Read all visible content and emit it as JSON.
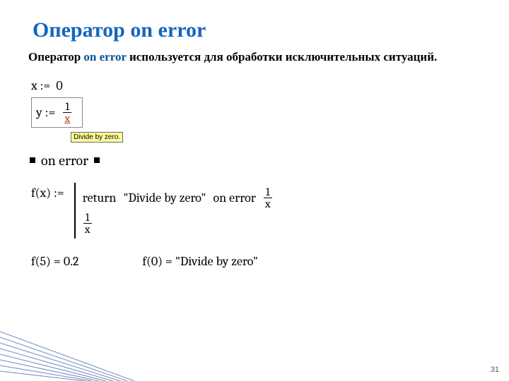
{
  "title": {
    "ru": "Оператор ",
    "kw": "on error"
  },
  "intro": {
    "pre": "Оператор ",
    "op": "on error",
    "post": " используется для обработки исключительных ситуаций."
  },
  "eq1": {
    "lhs": "x :=",
    "rhs": "0"
  },
  "eq2": {
    "lhs": "y :=",
    "num": "1",
    "den": "x"
  },
  "tooltip": "Divide by zero.",
  "stub_label": "on error",
  "fdef": {
    "lhs": "f(x) :=",
    "row1": {
      "return_kw": "return",
      "return_val": "\"Divide by zero\"",
      "on_error_kw": "on error",
      "num": "1",
      "den": "x"
    },
    "row2": {
      "num": "1",
      "den": "x"
    }
  },
  "results": {
    "a": "f(5)  =  0.2",
    "b": "f(0)  =  \"Divide by zero\""
  },
  "pagenum": "31"
}
